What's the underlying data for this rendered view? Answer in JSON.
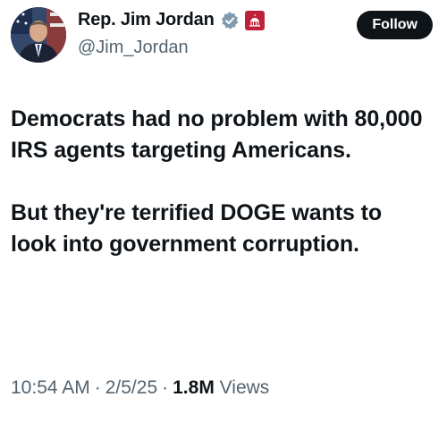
{
  "author": {
    "display_name": "Rep. Jim Jordan",
    "handle": "@Jim_Jordan",
    "avatar_icon": "profile-photo",
    "verified_icon": "verified-badge-icon",
    "affiliation_icon": "us-capitol-badge-icon",
    "verified_color": "#829aab",
    "affiliation_color": "#c0213a"
  },
  "actions": {
    "follow_label": "Follow"
  },
  "tweet": {
    "paragraphs": [
      "Democrats had no problem with 80,000 IRS agents targeting Americans.",
      "But they're terrified DOGE wants to look into government corruption."
    ]
  },
  "meta": {
    "time": "10:54 AM",
    "separator": "·",
    "date": "2/5/25",
    "views_count": "1.8M",
    "views_label": "Views"
  }
}
